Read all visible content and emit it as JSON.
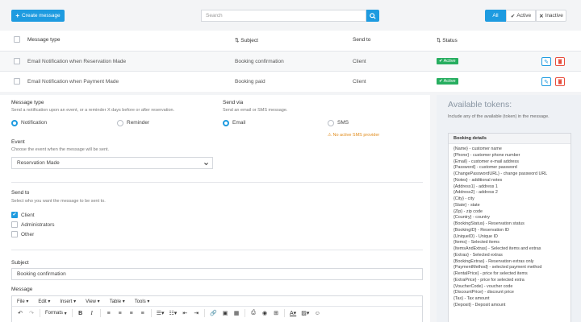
{
  "header": {
    "create_label": "Create message",
    "search_placeholder": "Search",
    "filters": {
      "all": "All",
      "active": "Active",
      "inactive": "Inactive"
    }
  },
  "table": {
    "columns": {
      "type": "Message type",
      "subject": "Subject",
      "send_to": "Send to",
      "status": "Status"
    },
    "rows": [
      {
        "type": "Email Notification when Reservation Made",
        "subject": "Booking confirmation",
        "send_to": "Client",
        "status": "Active"
      },
      {
        "type": "Email Notification when Payment Made",
        "subject": "Booking paid",
        "send_to": "Client",
        "status": "Active"
      }
    ]
  },
  "form": {
    "message_type": {
      "label": "Message type",
      "help": "Send a notification upon an event, or a reminder X days before or after reservation.",
      "options": {
        "notification": "Notification",
        "reminder": "Reminder"
      }
    },
    "send_via": {
      "label": "Send via",
      "help": "Send an email or SMS message.",
      "options": {
        "email": "Email",
        "sms": "SMS"
      },
      "warning": "No active SMS provider"
    },
    "event": {
      "label": "Event",
      "help": "Choose the event when the message will be sent.",
      "value": "Reservation Made"
    },
    "send_to": {
      "label": "Send to",
      "help": "Select who you want the message to be sent to.",
      "options": {
        "client": "Client",
        "administrators": "Administrators",
        "other": "Other"
      }
    },
    "subject": {
      "label": "Subject",
      "value": "Booking confirmation"
    },
    "message": {
      "label": "Message",
      "menu": {
        "file": "File",
        "edit": "Edit",
        "insert": "Insert",
        "view": "View",
        "table": "Table",
        "tools": "Tools"
      },
      "formats_label": "Formats"
    }
  },
  "tokens": {
    "title": "Available tokens:",
    "help": "Include any of the available (token) in the message.",
    "section": "Booking details",
    "items": [
      "{Name} - customer name",
      "{Phone} - customer phone number",
      "{Email} - customer e-mail address",
      "{Password} - customer password",
      "{ChangePasswordURL} - change password URL",
      "{Notes} - additional notes",
      "{Address1} - address 1",
      "{Address2} - address 2",
      "{City} - city",
      "{State} - state",
      "{Zip} - zip code",
      "{Country} - country",
      "{BookingStatus} - Reservation status",
      "{BookingID} - Reservation ID",
      "{UniqueID} - Unique ID",
      "{Items} - Selected items",
      "{ItemsAndExtras} - Selected items and extras",
      "{Extras} - Selected extras",
      "{BookingExtras} - Reservation extras only",
      "{PaymentMethod} - selected payment method",
      "{RentalPrice} - price for selected items",
      "{ExtraPrice} - price for selected extra",
      "{VoucherCode} - voucher code",
      "{DiscountPrice} - discount price",
      "{Tax} - Tax amount",
      "{Deposit} - Deposit amount"
    ]
  },
  "colors": {
    "primary": "#1e9be0",
    "success": "#27ae60",
    "danger": "#e74c3c",
    "warning": "#e08b1b"
  }
}
